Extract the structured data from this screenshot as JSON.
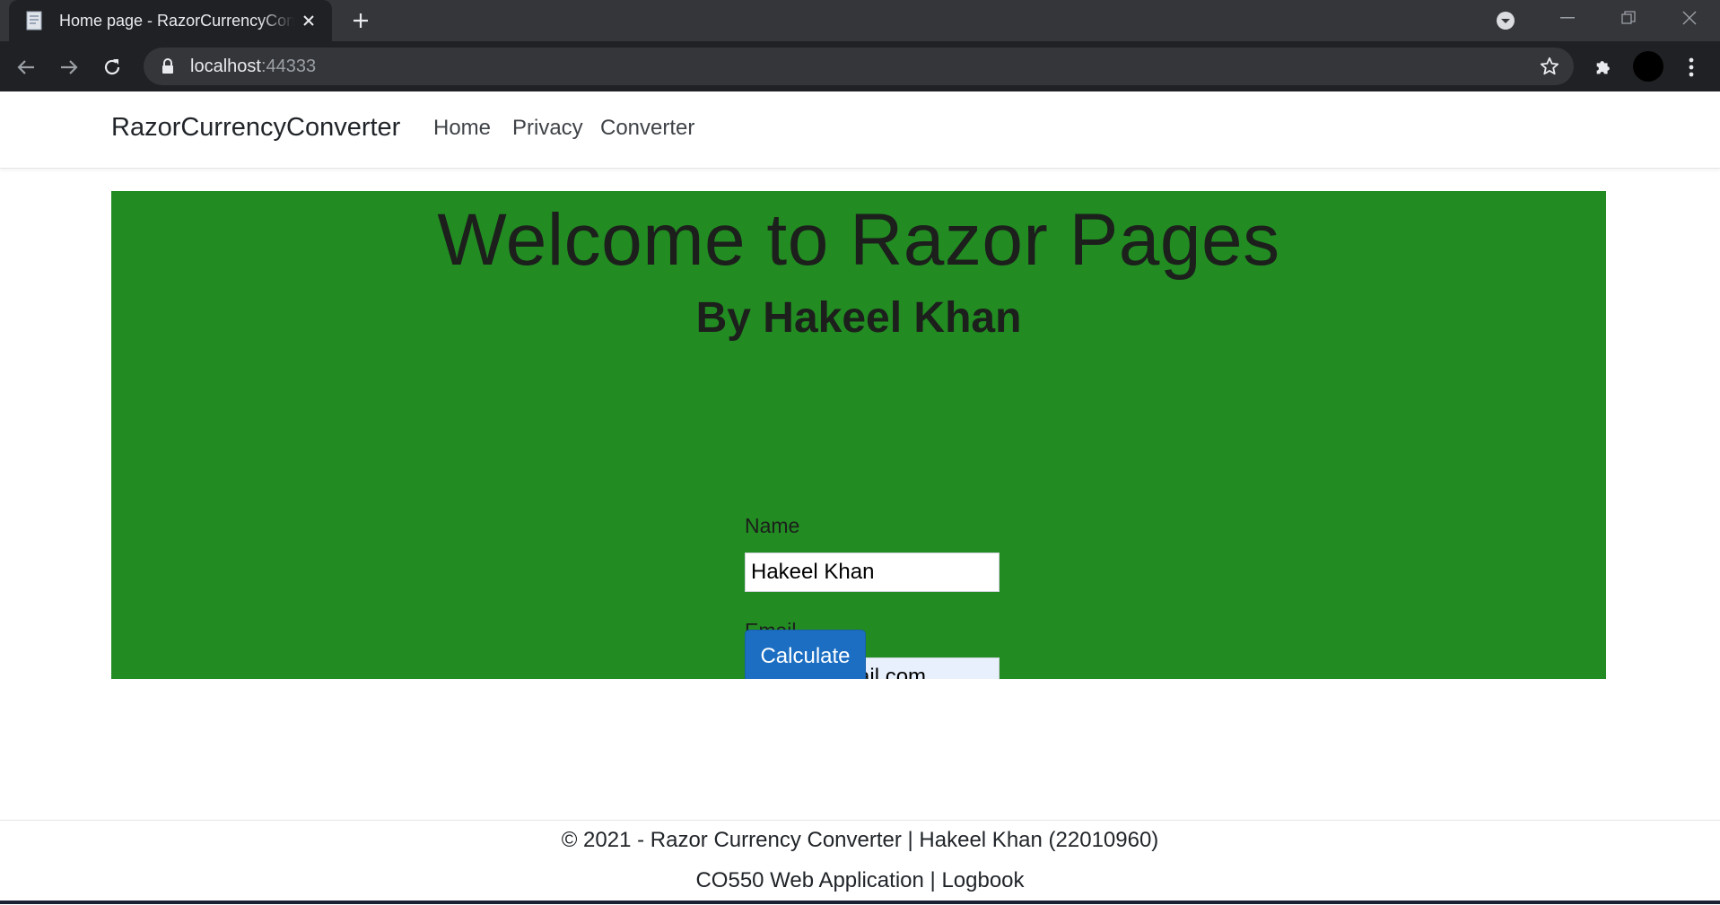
{
  "browser": {
    "tab_title": "Home page - RazorCurrencyConverter",
    "url_host": "localhost",
    "url_port": ":44333"
  },
  "navbar": {
    "brand": "RazorCurrencyConverter",
    "links": [
      "Home",
      "Privacy",
      "Converter"
    ]
  },
  "hero": {
    "title": "Welcome to Razor Pages",
    "subtitle": "By Hakeel Khan",
    "background_color": "#228b22"
  },
  "form": {
    "name_label": "Name",
    "name_value": "Hakeel Khan",
    "email_label": "Email",
    "email_value": "WWE@gmail.com",
    "submit_label": "Calculate"
  },
  "footer": {
    "copyright": "© 2021 - Razor Currency Converter | Hakeel Khan (22010960)",
    "link_webapp": "CO550 Web Application",
    "separator": "|",
    "link_logbook": "Logbook"
  },
  "colors": {
    "accent_button": "#1b6ec2",
    "chrome_dark": "#202124"
  }
}
